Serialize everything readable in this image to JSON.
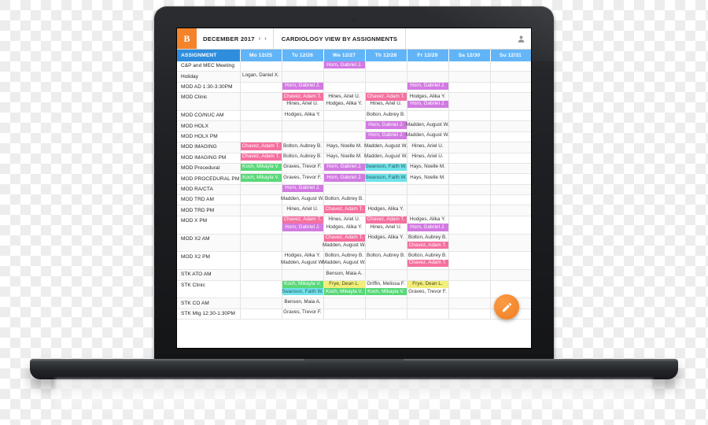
{
  "app": {
    "logo_text": "B",
    "month_label": "DECEMBER 2017",
    "prev_label": "‹",
    "next_label": "›",
    "view_title": "CARDIOLOGY VIEW BY ASSIGNMENTS",
    "account_icon": "user-icon",
    "fab_icon": "pencil-icon"
  },
  "colors": {
    "header_assignment": "#2f8ddd",
    "header_day": "#61b4f7",
    "brand_orange": "#f4832a",
    "chip_pink": "#f5709f",
    "chip_purple": "#d27ae2",
    "chip_green": "#58d878",
    "chip_cyan": "#6fe2ea",
    "chip_yellow": "#f2ef79"
  },
  "table": {
    "columns": [
      "ASSIGNMENT",
      "Mo 12/25",
      "Tu 12/26",
      "We 12/27",
      "Th 12/28",
      "Fr 12/29",
      "Sa 12/30",
      "Su 12/31"
    ],
    "rows": [
      {
        "label": "C&P and MEC Meeting",
        "cells": [
          [],
          [],
          [
            {
              "t": "Horn, Gabriel J.",
              "c": "purple"
            }
          ],
          [],
          [],
          [],
          []
        ]
      },
      {
        "label": "Holiday",
        "cells": [
          [
            {
              "t": "Logan, Daniel X.",
              "c": "plain"
            }
          ],
          [],
          [],
          [],
          [],
          [],
          []
        ]
      },
      {
        "label": "MOD AD 1:30-3:30PM",
        "cells": [
          [],
          [
            {
              "t": "Horn, Gabriel J.",
              "c": "purple"
            }
          ],
          [],
          [],
          [
            {
              "t": "Horn, Gabriel J.",
              "c": "purple"
            }
          ],
          [],
          []
        ]
      },
      {
        "label": "MOD Clinic",
        "cells": [
          [],
          [
            {
              "t": "Chavez, Adam T.",
              "c": "pink"
            },
            {
              "t": "Hines, Ariel U.",
              "c": "plain"
            }
          ],
          [
            {
              "t": "Hines, Ariel U.",
              "c": "plain"
            },
            {
              "t": "Hodges, Alika Y.",
              "c": "plain"
            }
          ],
          [
            {
              "t": "Chavez, Adam T.",
              "c": "pink"
            },
            {
              "t": "Hines, Ariel U.",
              "c": "plain"
            }
          ],
          [
            {
              "t": "Hodges, Alika Y.",
              "c": "plain"
            },
            {
              "t": "Horn, Gabriel J.",
              "c": "purple"
            }
          ],
          [],
          []
        ]
      },
      {
        "label": "MOD CO/NUC AM",
        "cells": [
          [],
          [
            {
              "t": "Hodges, Alika Y.",
              "c": "plain"
            }
          ],
          [],
          [
            {
              "t": "Bolton, Aubrey B.",
              "c": "plain"
            }
          ],
          [],
          [],
          []
        ]
      },
      {
        "label": "MOD HOLX",
        "cells": [
          [],
          [],
          [],
          [
            {
              "t": "Horn, Gabriel J.",
              "c": "purple"
            }
          ],
          [
            {
              "t": "Madden, August W.",
              "c": "plain"
            }
          ],
          [],
          []
        ]
      },
      {
        "label": "MOD HOLX PM",
        "cells": [
          [],
          [],
          [],
          [
            {
              "t": "Horn, Gabriel J.",
              "c": "purple"
            }
          ],
          [
            {
              "t": "Madden, August W.",
              "c": "plain"
            }
          ],
          [],
          []
        ]
      },
      {
        "label": "MOD IMAGING",
        "cells": [
          [
            {
              "t": "Chavez, Adam T.",
              "c": "pink"
            }
          ],
          [
            {
              "t": "Bolton, Aubrey B.",
              "c": "plain"
            }
          ],
          [
            {
              "t": "Hays, Noelle M.",
              "c": "plain"
            }
          ],
          [
            {
              "t": "Madden, August W.",
              "c": "plain"
            }
          ],
          [
            {
              "t": "Hines, Ariel U.",
              "c": "plain"
            }
          ],
          [],
          []
        ]
      },
      {
        "label": "MOD IMAGING PM",
        "cells": [
          [
            {
              "t": "Chavez, Adam T.",
              "c": "pink"
            }
          ],
          [
            {
              "t": "Bolton, Aubrey B.",
              "c": "plain"
            }
          ],
          [
            {
              "t": "Hays, Noelle M.",
              "c": "plain"
            }
          ],
          [
            {
              "t": "Madden, August W.",
              "c": "plain"
            }
          ],
          [
            {
              "t": "Hines, Ariel U.",
              "c": "plain"
            }
          ],
          [],
          []
        ]
      },
      {
        "label": "MOD Procedural",
        "cells": [
          [
            {
              "t": "Koch, Mikayla V.",
              "c": "green"
            }
          ],
          [
            {
              "t": "Graves, Trevor F.",
              "c": "plain"
            }
          ],
          [
            {
              "t": "Horn, Gabriel J.",
              "c": "purple"
            }
          ],
          [
            {
              "t": "Swanson, Faith W.",
              "c": "cyan"
            }
          ],
          [
            {
              "t": "Hays, Noelle M.",
              "c": "plain"
            }
          ],
          [],
          []
        ]
      },
      {
        "label": "MOD PROCEDURAL PM",
        "cells": [
          [
            {
              "t": "Koch, Mikayla V.",
              "c": "green"
            }
          ],
          [
            {
              "t": "Graves, Trevor F.",
              "c": "plain"
            }
          ],
          [
            {
              "t": "Horn, Gabriel J.",
              "c": "purple"
            }
          ],
          [
            {
              "t": "Swanson, Faith W.",
              "c": "cyan"
            }
          ],
          [
            {
              "t": "Hays, Noelle M.",
              "c": "plain"
            }
          ],
          [],
          []
        ]
      },
      {
        "label": "MOD RA/CTA",
        "cells": [
          [],
          [
            {
              "t": "Horn, Gabriel J.",
              "c": "purple"
            }
          ],
          [],
          [],
          [],
          [],
          []
        ]
      },
      {
        "label": "MOD TRD AM",
        "cells": [
          [],
          [
            {
              "t": "Madden, August W.",
              "c": "plain"
            }
          ],
          [
            {
              "t": "Bolton, Aubrey B.",
              "c": "plain"
            }
          ],
          [],
          [],
          [],
          []
        ]
      },
      {
        "label": "MOD TRD PM",
        "cells": [
          [],
          [
            {
              "t": "Hines, Ariel U.",
              "c": "plain"
            }
          ],
          [
            {
              "t": "Chavez, Adam T.",
              "c": "pink"
            }
          ],
          [
            {
              "t": "Hodges, Alika Y.",
              "c": "plain"
            }
          ],
          [],
          [],
          []
        ]
      },
      {
        "label": "MOD X PM",
        "cells": [
          [],
          [
            {
              "t": "Chavez, Adam T.",
              "c": "pink"
            },
            {
              "t": "Horn, Gabriel J.",
              "c": "purple"
            }
          ],
          [
            {
              "t": "Hines, Ariel U.",
              "c": "plain"
            },
            {
              "t": "Hodges, Alika Y.",
              "c": "plain"
            }
          ],
          [
            {
              "t": "Chavez, Adam T.",
              "c": "pink"
            },
            {
              "t": "Hines, Ariel U.",
              "c": "plain"
            }
          ],
          [
            {
              "t": "Hodges, Alika Y.",
              "c": "plain"
            },
            {
              "t": "Horn, Gabriel J.",
              "c": "purple"
            }
          ],
          [],
          []
        ]
      },
      {
        "label": "MOD X2 AM",
        "cells": [
          [],
          [],
          [
            {
              "t": "Chavez, Adam T.",
              "c": "pink"
            },
            {
              "t": "Madden, August W.",
              "c": "plain"
            }
          ],
          [
            {
              "t": "Hodges, Alika Y.",
              "c": "plain"
            }
          ],
          [
            {
              "t": "Bolton, Aubrey B.",
              "c": "plain"
            },
            {
              "t": "Chavez, Adam T.",
              "c": "pink"
            }
          ],
          [],
          []
        ]
      },
      {
        "label": "MOD X2 PM",
        "cells": [
          [],
          [
            {
              "t": "Hodges, Alika Y.",
              "c": "plain"
            },
            {
              "t": "Madden, August W.",
              "c": "plain"
            }
          ],
          [
            {
              "t": "Bolton, Aubrey B.",
              "c": "plain"
            },
            {
              "t": "Madden, August W.",
              "c": "plain"
            }
          ],
          [
            {
              "t": "Bolton, Aubrey B.",
              "c": "plain"
            }
          ],
          [
            {
              "t": "Bolton, Aubrey B.",
              "c": "plain"
            },
            {
              "t": "Chavez, Adam T.",
              "c": "pink"
            }
          ],
          [],
          []
        ]
      },
      {
        "label": "STK ATO AM",
        "cells": [
          [],
          [],
          [
            {
              "t": "Benson, Maia A.",
              "c": "plain"
            }
          ],
          [],
          [],
          [],
          []
        ]
      },
      {
        "label": "STK Clinic",
        "cells": [
          [],
          [
            {
              "t": "Koch, Mikayla V.",
              "c": "green"
            },
            {
              "t": "Swanson, Faith W.",
              "c": "cyan"
            }
          ],
          [
            {
              "t": "Frye, Dean L.",
              "c": "yellow"
            },
            {
              "t": "Koch, Mikayla V.",
              "c": "green"
            }
          ],
          [
            {
              "t": "Griffin, Melissa F.",
              "c": "plain"
            },
            {
              "t": "Koch, Mikayla V.",
              "c": "green"
            }
          ],
          [
            {
              "t": "Frye, Dean L.",
              "c": "yellow"
            },
            {
              "t": "Graves, Trevor F.",
              "c": "plain"
            }
          ],
          [],
          []
        ]
      },
      {
        "label": "STK CO AM",
        "cells": [
          [],
          [
            {
              "t": "Benson, Maia A.",
              "c": "plain"
            }
          ],
          [],
          [],
          [],
          [],
          []
        ]
      },
      {
        "label": "STK Mtg 12:30-1:30PM",
        "cells": [
          [],
          [
            {
              "t": "Graves, Trevor F.",
              "c": "plain"
            }
          ],
          [],
          [],
          [],
          [],
          []
        ]
      }
    ]
  }
}
